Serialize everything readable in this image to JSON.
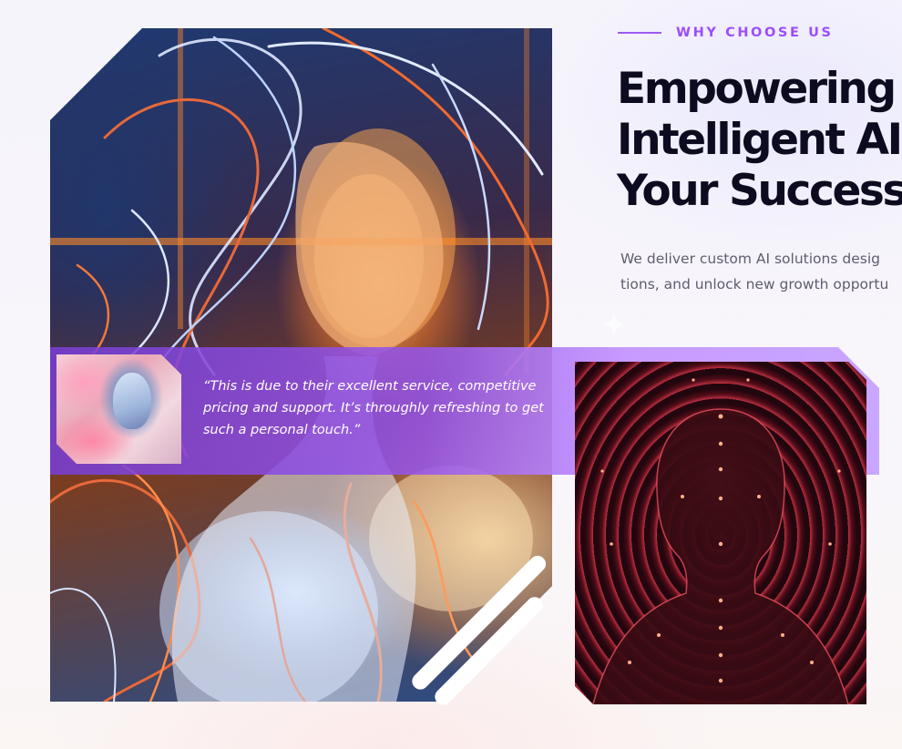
{
  "section": {
    "eyebrow": "WHY CHOOSE US",
    "headline": {
      "line1": "Empowering I",
      "line2": "Intelligent AI S",
      "line3": "Your Success."
    },
    "description": {
      "line1": "We deliver custom AI solutions desig",
      "line2": "tions, and unlock new growth opportu"
    }
  },
  "testimonial": {
    "quote": "“This is due to their excellent service, competitive pricing and support. It’s throughly refreshing to get such a personal touch.”"
  },
  "colors": {
    "accent": "#9b4dff",
    "heading": "#0d0b1f",
    "body_text": "#5f5d6e",
    "testimonial_band": "#8a4fe6"
  },
  "icons": {
    "sparkle": "sparkle-icon"
  }
}
